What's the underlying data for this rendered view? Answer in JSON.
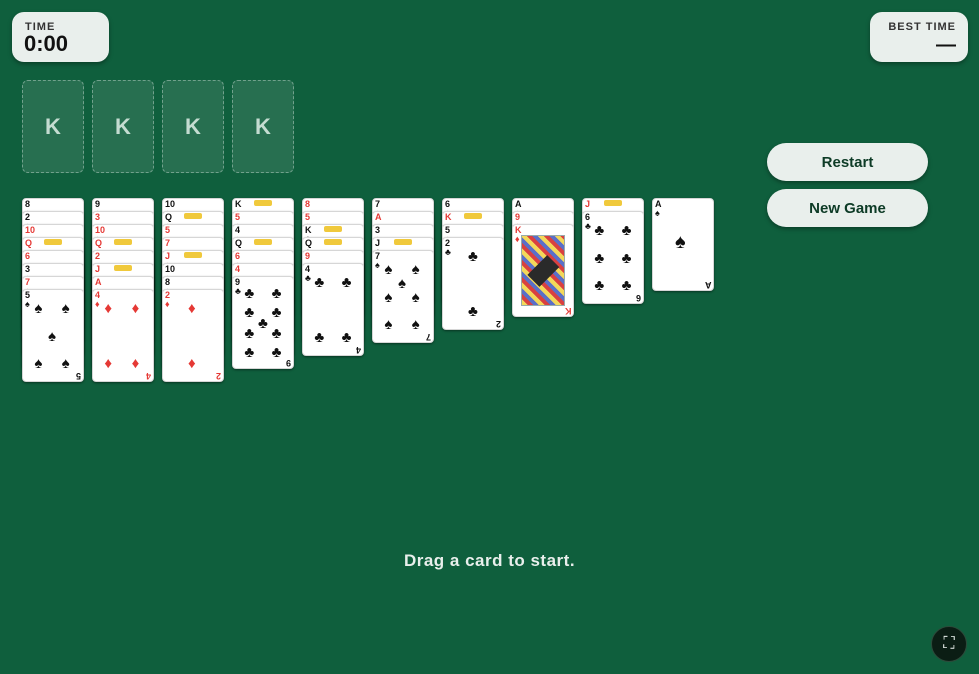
{
  "timer": {
    "label": "TIME",
    "value": "0:00"
  },
  "best_time": {
    "label": "BEST TIME",
    "value": "—"
  },
  "foundations": [
    {
      "placeholder": "K"
    },
    {
      "placeholder": "K"
    },
    {
      "placeholder": "K"
    },
    {
      "placeholder": "K"
    }
  ],
  "buttons": {
    "restart": "Restart",
    "new_game": "New Game"
  },
  "status_message": "Drag a card to start.",
  "icons": {
    "fullscreen": "fullscreen-icon"
  },
  "colors": {
    "felt": "#0f5f3d",
    "panel": "#e9efec",
    "red_suit": "#e53935",
    "black_suit": "#111111"
  },
  "tableau": [
    {
      "cards": [
        {
          "rank": "8",
          "suit": "♠",
          "color": "black",
          "face_up": true
        },
        {
          "rank": "2",
          "suit": "♠",
          "color": "black",
          "face_up": true
        },
        {
          "rank": "10",
          "suit": "♥",
          "color": "red",
          "face_up": true
        },
        {
          "rank": "Q",
          "suit": "♥",
          "color": "red",
          "face_up": true
        },
        {
          "rank": "6",
          "suit": "♥",
          "color": "red",
          "face_up": true
        },
        {
          "rank": "3",
          "suit": "♠",
          "color": "black",
          "face_up": true
        },
        {
          "rank": "7",
          "suit": "♦",
          "color": "red",
          "face_up": true
        },
        {
          "rank": "5",
          "suit": "♠",
          "color": "black",
          "face_up": true
        }
      ]
    },
    {
      "cards": [
        {
          "rank": "9",
          "suit": "♠",
          "color": "black",
          "face_up": true
        },
        {
          "rank": "3",
          "suit": "♥",
          "color": "red",
          "face_up": true
        },
        {
          "rank": "10",
          "suit": "♦",
          "color": "red",
          "face_up": true
        },
        {
          "rank": "Q",
          "suit": "♦",
          "color": "red",
          "face_up": true
        },
        {
          "rank": "2",
          "suit": "♥",
          "color": "red",
          "face_up": true
        },
        {
          "rank": "J",
          "suit": "♥",
          "color": "red",
          "face_up": true
        },
        {
          "rank": "A",
          "suit": "♦",
          "color": "red",
          "face_up": true
        },
        {
          "rank": "4",
          "suit": "♦",
          "color": "red",
          "face_up": true
        }
      ]
    },
    {
      "cards": [
        {
          "rank": "10",
          "suit": "♠",
          "color": "black",
          "face_up": true
        },
        {
          "rank": "Q",
          "suit": "♠",
          "color": "black",
          "face_up": true
        },
        {
          "rank": "5",
          "suit": "♥",
          "color": "red",
          "face_up": true
        },
        {
          "rank": "7",
          "suit": "♥",
          "color": "red",
          "face_up": true
        },
        {
          "rank": "J",
          "suit": "♦",
          "color": "red",
          "face_up": true
        },
        {
          "rank": "10",
          "suit": "♠",
          "color": "black",
          "face_up": true
        },
        {
          "rank": "8",
          "suit": "♠",
          "color": "black",
          "face_up": true
        },
        {
          "rank": "2",
          "suit": "♦",
          "color": "red",
          "face_up": true
        }
      ]
    },
    {
      "cards": [
        {
          "rank": "K",
          "suit": "♠",
          "color": "black",
          "face_up": true
        },
        {
          "rank": "5",
          "suit": "♦",
          "color": "red",
          "face_up": true
        },
        {
          "rank": "4",
          "suit": "♠",
          "color": "black",
          "face_up": true
        },
        {
          "rank": "Q",
          "suit": "♠",
          "color": "black",
          "face_up": true
        },
        {
          "rank": "6",
          "suit": "♦",
          "color": "red",
          "face_up": true
        },
        {
          "rank": "4",
          "suit": "♥",
          "color": "red",
          "face_up": true
        },
        {
          "rank": "9",
          "suit": "♣",
          "color": "black",
          "face_up": true
        }
      ]
    },
    {
      "cards": [
        {
          "rank": "8",
          "suit": "♥",
          "color": "red",
          "face_up": true
        },
        {
          "rank": "5",
          "suit": "♦",
          "color": "red",
          "face_up": true
        },
        {
          "rank": "K",
          "suit": "♣",
          "color": "black",
          "face_up": true
        },
        {
          "rank": "Q",
          "suit": "♣",
          "color": "black",
          "face_up": true
        },
        {
          "rank": "9",
          "suit": "♥",
          "color": "red",
          "face_up": true
        },
        {
          "rank": "4",
          "suit": "♣",
          "color": "black",
          "face_up": true
        }
      ]
    },
    {
      "cards": [
        {
          "rank": "7",
          "suit": "♠",
          "color": "black",
          "face_up": true
        },
        {
          "rank": "A",
          "suit": "♥",
          "color": "red",
          "face_up": true
        },
        {
          "rank": "3",
          "suit": "♠",
          "color": "black",
          "face_up": true
        },
        {
          "rank": "J",
          "suit": "♣",
          "color": "black",
          "face_up": true
        },
        {
          "rank": "7",
          "suit": "♠",
          "color": "black",
          "face_up": true
        }
      ]
    },
    {
      "cards": [
        {
          "rank": "6",
          "suit": "♠",
          "color": "black",
          "face_up": true
        },
        {
          "rank": "K",
          "suit": "♥",
          "color": "red",
          "face_up": true
        },
        {
          "rank": "5",
          "suit": "♠",
          "color": "black",
          "face_up": true
        },
        {
          "rank": "2",
          "suit": "♣",
          "color": "black",
          "face_up": true
        }
      ]
    },
    {
      "cards": [
        {
          "rank": "A",
          "suit": "♠",
          "color": "black",
          "face_up": true
        },
        {
          "rank": "9",
          "suit": "♦",
          "color": "red",
          "face_up": true
        },
        {
          "rank": "K",
          "suit": "♦",
          "color": "red",
          "face_up": true
        }
      ]
    },
    {
      "cards": [
        {
          "rank": "J",
          "suit": "♥",
          "color": "red",
          "face_up": true
        },
        {
          "rank": "6",
          "suit": "♣",
          "color": "black",
          "face_up": true
        }
      ]
    },
    {
      "cards": [
        {
          "rank": "A",
          "suit": "♠",
          "color": "black",
          "face_up": true
        }
      ]
    }
  ]
}
